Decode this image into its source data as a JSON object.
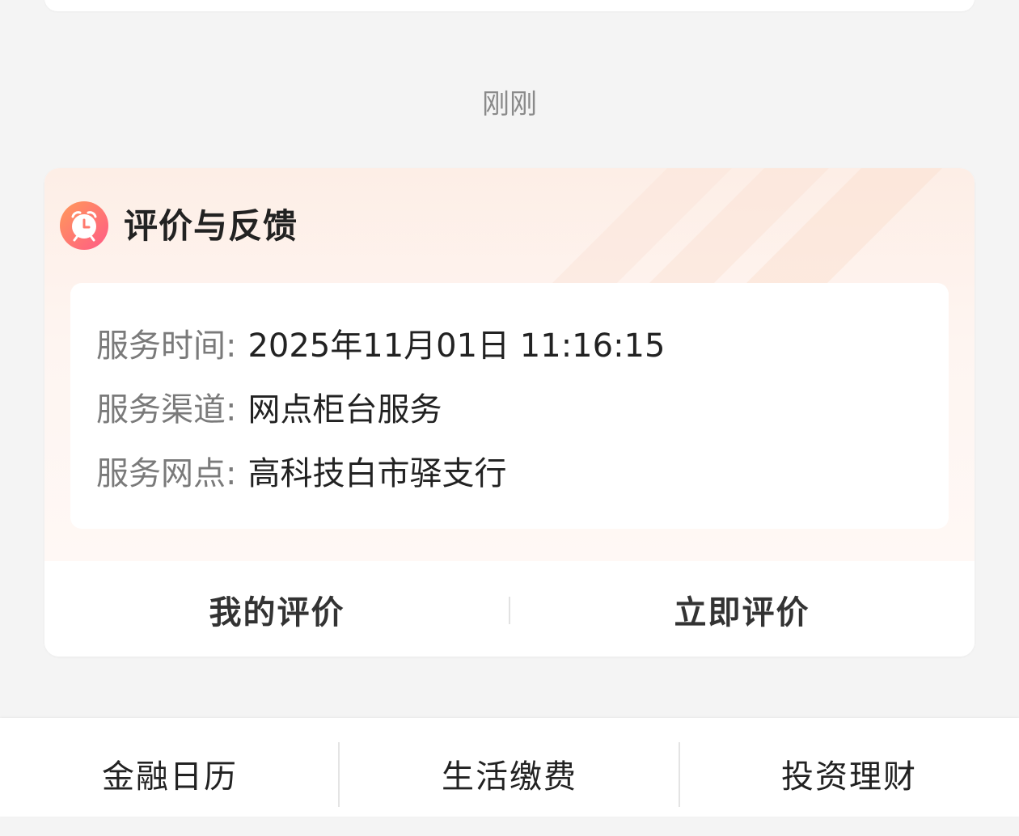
{
  "timestamp": "刚刚",
  "card": {
    "title": "评价与反馈",
    "rows": [
      {
        "label": "服务时间:",
        "value": "2025年11月01日 11:16:15"
      },
      {
        "label": "服务渠道:",
        "value": "网点柜台服务"
      },
      {
        "label": "服务网点:",
        "value": "高科技白市驿支行"
      }
    ],
    "actions": {
      "my_review": "我的评价",
      "review_now": "立即评价"
    }
  },
  "bottom_nav": [
    "金融日历",
    "生活缴费",
    "投资理财"
  ],
  "icons": {
    "card_icon": "alarm-clock-icon"
  },
  "colors": {
    "icon_gradient_start": "#ff9a5a",
    "icon_gradient_end": "#ff5a86",
    "card_header_bg": "#fdeee6"
  }
}
